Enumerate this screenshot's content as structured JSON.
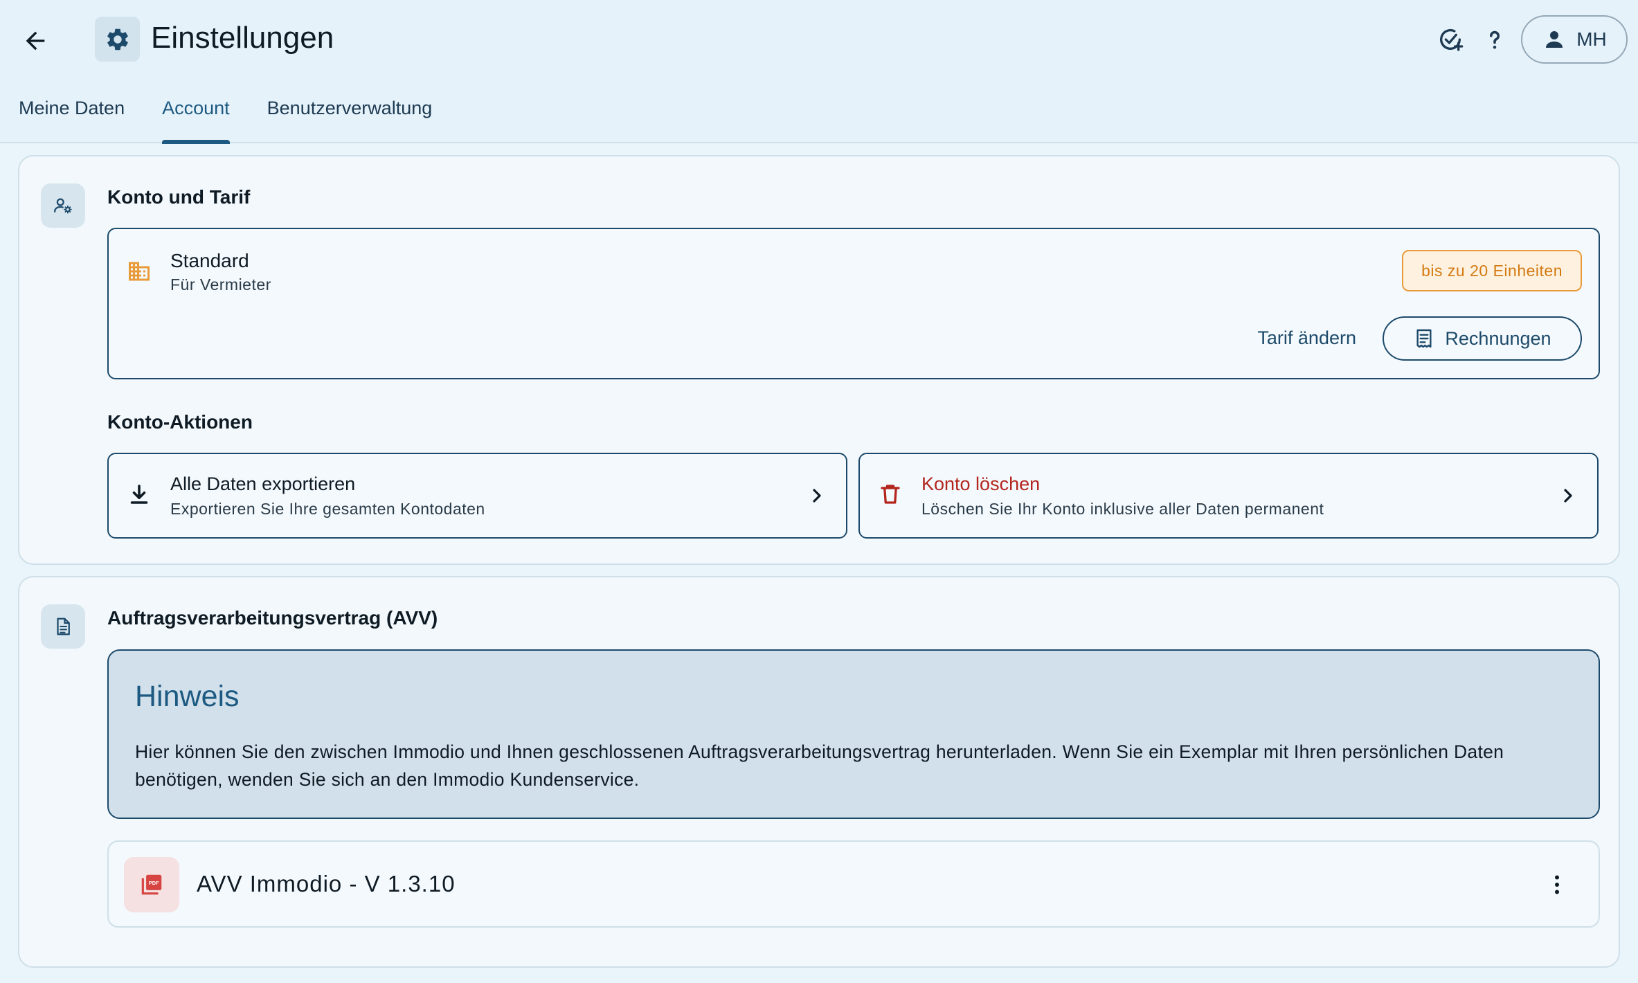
{
  "header": {
    "title": "Einstellungen",
    "user_initials": "MH"
  },
  "tabs": [
    {
      "label": "Meine Daten",
      "active": false
    },
    {
      "label": "Account",
      "active": true
    },
    {
      "label": "Benutzerverwaltung",
      "active": false
    }
  ],
  "account_card": {
    "title": "Konto und Tarif",
    "plan": {
      "name": "Standard",
      "subtitle": "Für Vermieter",
      "badge": "bis zu 20 Einheiten",
      "change_label": "Tarif ändern",
      "invoices_label": "Rechnungen"
    },
    "actions_title": "Konto-Aktionen",
    "actions": [
      {
        "title": "Alle Daten exportieren",
        "subtitle": "Exportieren Sie Ihre gesamten Kontodaten"
      },
      {
        "title": "Konto löschen",
        "subtitle": "Löschen Sie Ihr Konto inklusive aller Daten permanent"
      }
    ]
  },
  "avv_card": {
    "title": "Auftragsverarbeitungsvertrag (AVV)",
    "hint_title": "Hinweis",
    "hint_text": "Hier können Sie den zwischen Immodio und Ihnen geschlossenen Auftragsverarbeitungsvertrag herunterladen. Wenn Sie ein Exemplar mit Ihren persönlichen Daten benötigen, wenden Sie sich an den Immodio Kundenservice.",
    "file_name": "AVV Immodio - V 1.3.10"
  },
  "colors": {
    "primary": "#1d4a6a",
    "accent_orange": "#e99b3a",
    "danger": "#b3261e",
    "hint_bg": "#d1e0ea"
  }
}
